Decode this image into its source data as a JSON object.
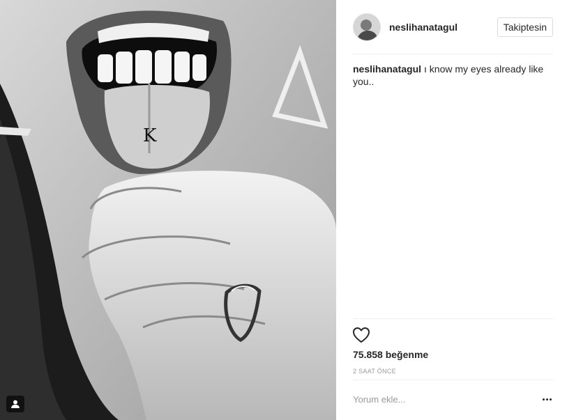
{
  "header": {
    "username": "neslihanatagul",
    "follow_label": "Takiptesin"
  },
  "caption": {
    "username": "neslihanatagul",
    "text": "ı know my eyes already like you.."
  },
  "actions": {
    "like_icon": "heart-icon"
  },
  "stats": {
    "likes": "75.858 beğenme",
    "time": "2 SAAT ÖNCE"
  },
  "comment": {
    "placeholder": "Yorum ekle..."
  },
  "photo": {
    "tag_icon": "user-tag-icon",
    "tattoo_letter": "K"
  }
}
